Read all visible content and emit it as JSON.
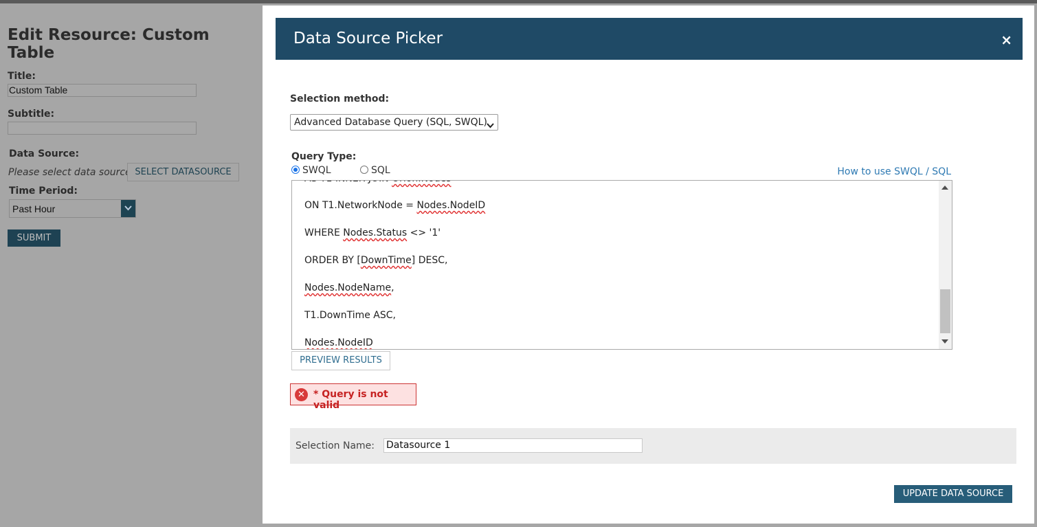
{
  "page": {
    "heading": "Edit Resource: Custom Table",
    "title_label": "Title:",
    "title_value": "Custom Table",
    "subtitle_label": "Subtitle:",
    "subtitle_value": "",
    "datasource_label": "Data Source:",
    "datasource_placeholder": "Please select data source",
    "select_datasource_button": "SELECT DATASOURCE",
    "time_period_label": "Time Period:",
    "time_period_value": "Past Hour",
    "submit_button": "SUBMIT"
  },
  "modal": {
    "title": "Data Source Picker",
    "close_icon": "×",
    "selection_method_label": "Selection method:",
    "selection_method_value": "Advanced Database Query (SQL, SWQL)",
    "query_type_label": "Query Type:",
    "query_types": [
      {
        "label": "SWQL",
        "selected": true
      },
      {
        "label": "SQL",
        "selected": false
      }
    ],
    "help_link": "How to use SWQL / SQL",
    "query_lines": [
      "ON T1.NetworkNode = Nodes.NodeID",
      "WHERE Nodes.Status <> '1'",
      "ORDER BY [DownTime] DESC,",
      "Nodes.NodeName,",
      "T1.DownTime ASC,",
      "Nodes.NodeID"
    ],
    "preview_button": "PREVIEW RESULTS",
    "error_message": "* Query is not valid",
    "error_icon": "x-circle-icon",
    "selection_name_label": "Selection Name:",
    "selection_name_value": "Datasource 1",
    "update_button": "UPDATE DATA SOURCE"
  },
  "colors": {
    "header": "#1f4a66",
    "primary_button": "#275d79",
    "link": "#2f7ab3",
    "error": "#c62222"
  }
}
